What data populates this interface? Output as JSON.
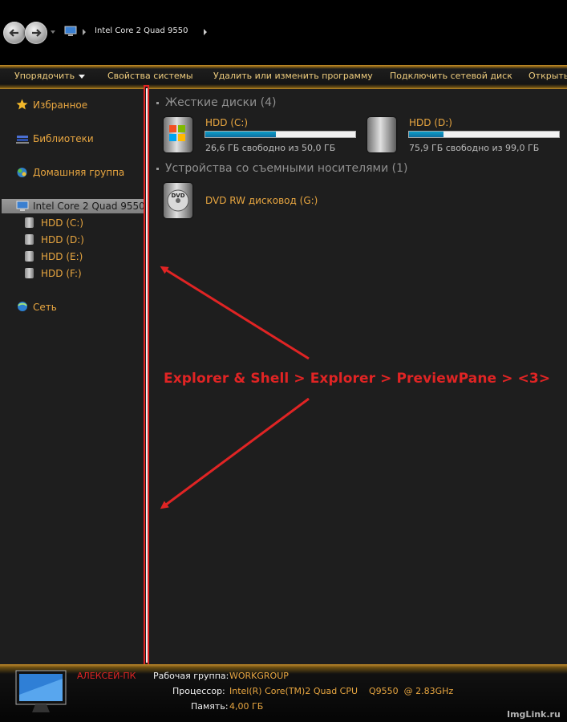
{
  "window": {
    "breadcrumb": "Intel Core 2 Quad 9550"
  },
  "toolbar": {
    "organize": "Упорядочить",
    "system_properties": "Свойства системы",
    "uninstall": "Удалить или изменить программу",
    "map_drive": "Подключить сетевой диск",
    "open": "Открыть"
  },
  "sidebar": {
    "favorites": "Избранное",
    "libraries": "Библиотеки",
    "homegroup": "Домашняя группа",
    "computer": "Intel Core 2 Quad 9550",
    "drives": [
      "HDD (C:)",
      "HDD (D:)",
      "HDD (E:)",
      "HDD (F:)"
    ],
    "network": "Сеть"
  },
  "content": {
    "hard_disks_header": "Жесткие диски (4)",
    "removable_header": "Устройства со съемными носителями (1)",
    "drives": [
      {
        "name": "HDD (C:)",
        "info": "26,6 ГБ свободно из 50,0 ГБ",
        "used_fraction": 0.47
      },
      {
        "name": "HDD (D:)",
        "info": "75,9 ГБ свободно из 99,0 ГБ",
        "used_fraction": 0.23
      }
    ],
    "dvd": {
      "name": "DVD RW дисковод (G:)",
      "icon_text": "DVD"
    }
  },
  "annotation": "Explorer & Shell > Explorer > PreviewPane > <3>",
  "details": {
    "pc_name": "АЛЕКСЕЙ-ПК",
    "workgroup_label": "Рабочая группа:",
    "workgroup": "WORKGROUP",
    "cpu_label": "Процессор:",
    "cpu": "Intel(R) Core(TM)2 Quad CPU    Q9550  @ 2.83GHz",
    "memory_label": "Память:",
    "memory": "4,00 ГБ"
  },
  "watermark": "ImgLink.ru",
  "colors": {
    "accent_gold": "#e8a640",
    "annotation_red": "#e02424",
    "progress_blue": "#0c9ec9"
  }
}
